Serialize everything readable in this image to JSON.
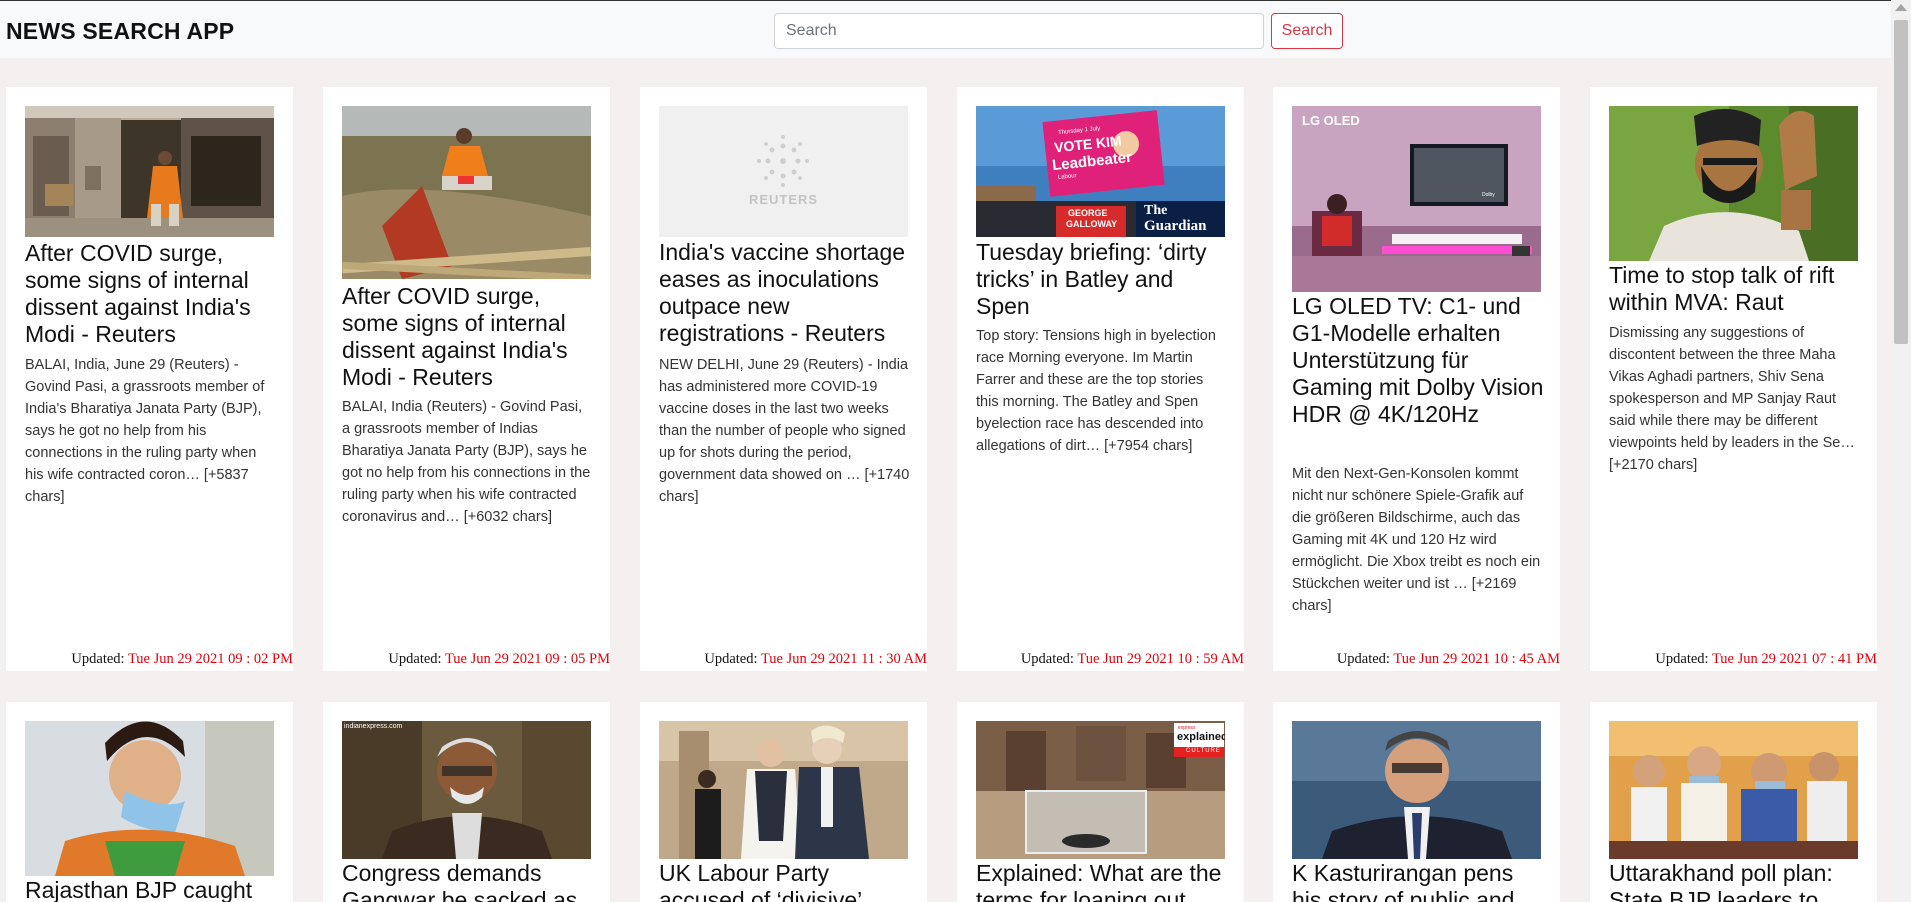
{
  "app": {
    "title": "NEWS SEARCH APP",
    "search_placeholder": "Search",
    "search_value": "",
    "search_button": "Search"
  },
  "updated_label": "Updated:",
  "articles": [
    {
      "title": "After COVID surge, some signs of internal dissent against India's Modi - Reuters",
      "description": "BALAI, India, June 29 (Reuters) - Govind Pasi, a grassroots member of India's Bharatiya Janata Party (BJP), says he got no help from his connections in the ruling party when his wife contracted coron… [+5837 chars]",
      "updated": "Tue Jun 29 2021 09 : 02 PM"
    },
    {
      "title": "After COVID surge, some signs of internal dissent against India's Modi - Reuters",
      "description": "BALAI, India (Reuters) - Govind Pasi, a grassroots member of Indias Bharatiya Janata Party (BJP), says he got no help from his connections in the ruling party when his wife contracted coronavirus and… [+6032 chars]",
      "updated": "Tue Jun 29 2021 09 : 05 PM"
    },
    {
      "title": "India's vaccine shortage eases as inoculations outpace new registrations - Reuters",
      "description": "NEW DELHI, June 29 (Reuters) - India has administered more COVID-19 vaccine doses in the last two weeks than the number of people who signed up for shots during the period, government data showed on … [+1740 chars]",
      "updated": "Tue Jun 29 2021 11 : 30 AM",
      "image_logo_text": "REUTERS"
    },
    {
      "title": "Tuesday briefing: ‘dirty tricks’ in Batley and Spen",
      "description": "Top story: Tensions high in byelection race Morning everyone. Im Martin Farrer and these are the top stories this morning. The Batley and Spen byelection race has descended into allegations of dirt… [+7954 chars]",
      "updated": "Tue Jun 29 2021 10 : 59 AM",
      "image_text": {
        "poster_small": "Thursday 1 July",
        "poster_line1": "VOTE KIM",
        "poster_line2": "Leadbeater",
        "poster_party": "Labour",
        "lower_sign_line1": "GEORGE",
        "lower_sign_line2": "GALLOWAY",
        "masthead_line1": "The",
        "masthead_line2": "Guardian"
      }
    },
    {
      "title": "LG OLED TV: C1- und G1-Modelle erhalten Unterstützung für Gaming mit Dolby Vision HDR @ 4K/120Hz",
      "description": "Mit den Next-Gen-Konsolen kommt nicht nur schönere Spiele-Grafik auf die größeren Bildschirme, auch das Gaming mit 4K und 120 Hz wird ermöglicht. Die Xbox treibt es noch ein Stückchen weiter und ist … [+2169 chars]",
      "updated": "Tue Jun 29 2021 10 : 45 AM",
      "image_text": {
        "brand": "LG OLED",
        "badge": "Dolby"
      }
    },
    {
      "title": "Time to stop talk of rift within MVA: Raut",
      "description": "Dismissing any suggestions of discontent between the three Maha Vikas Aghadi partners, Shiv Sena spokesperson and MP Sanjay Raut said while there may be different viewpoints held by leaders in the Se… [+2170 chars]",
      "updated": "Tue Jun 29 2021 07 : 41 PM"
    },
    {
      "title": "Rajasthan BJP caught",
      "description": "",
      "updated": ""
    },
    {
      "title": "Congress demands Gangwar be sacked as",
      "description": "",
      "updated": "",
      "image_text": {
        "source": "indianexpress.com"
      }
    },
    {
      "title": "UK Labour Party accused of ‘divisive’",
      "description": "",
      "updated": ""
    },
    {
      "title": "Explained: What are the terms for loaning out",
      "description": "",
      "updated": "",
      "image_text": {
        "badge_top": "express",
        "badge_main": "explained.",
        "badge_sub": "CULTURE"
      }
    },
    {
      "title": "K Kasturirangan pens his story of public and",
      "description": "",
      "updated": ""
    },
    {
      "title": "Uttarakhand poll plan: State BJP leaders to",
      "description": "",
      "updated": ""
    }
  ]
}
